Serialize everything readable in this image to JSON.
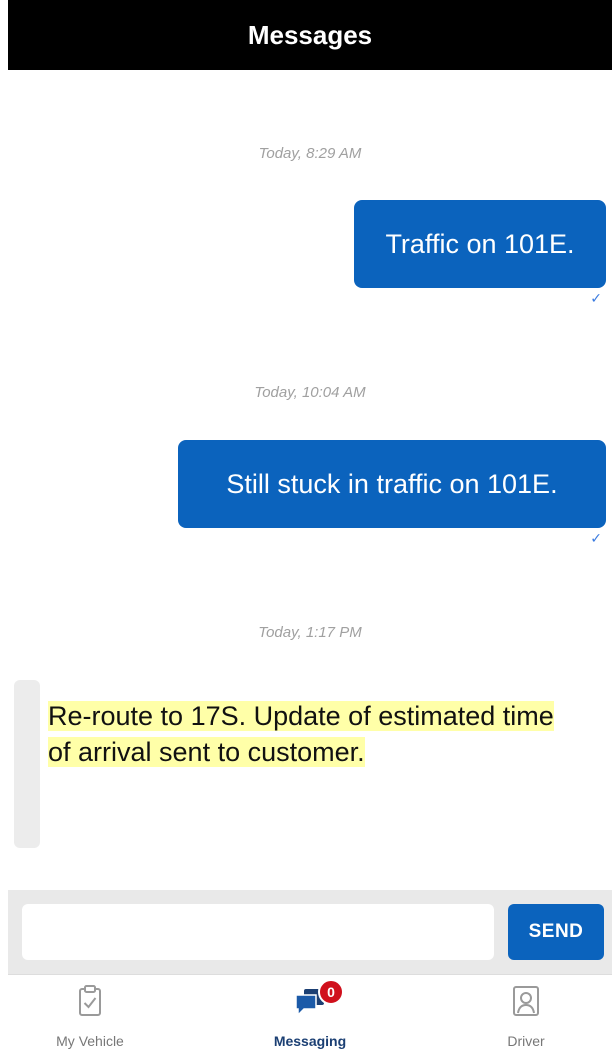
{
  "header": {
    "title": "Messages"
  },
  "conversation": [
    {
      "timestamp": "Today, 8:29 AM",
      "direction": "outgoing",
      "text": "Traffic on 101E.",
      "status": "✓"
    },
    {
      "timestamp": "Today, 10:04 AM",
      "direction": "outgoing",
      "text": "Still stuck in traffic on 101E.",
      "status": "✓"
    },
    {
      "timestamp": "Today, 1:17 PM",
      "direction": "incoming",
      "text": "Re-route to 17S. Update of estimated time of arrival sent to customer."
    }
  ],
  "composer": {
    "placeholder": "",
    "value": "",
    "send_label": "SEND"
  },
  "tabs": [
    {
      "label": "My Vehicle",
      "icon": "clipboard-check-icon",
      "active": false
    },
    {
      "label": "Messaging",
      "icon": "chat-bubbles-icon",
      "active": true,
      "badge": "0"
    },
    {
      "label": "Driver",
      "icon": "driver-profile-icon",
      "active": false
    }
  ],
  "colors": {
    "header_bg": "#000000",
    "accent": "#0b63bd",
    "highlight": "#ffffa8",
    "badge": "#d0101c",
    "active_tab": "#1b3f73"
  }
}
